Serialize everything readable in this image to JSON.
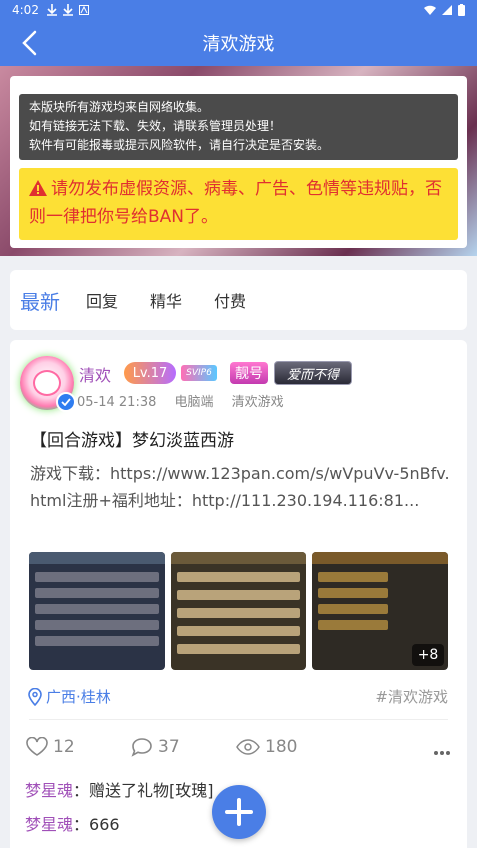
{
  "status_bar": {
    "time": "4:02"
  },
  "app_bar": {
    "title": "清欢游戏"
  },
  "notice": {
    "lines": [
      "本版块所有游戏均来自网络收集。",
      "如有链接无法下载、失效，请联系管理员处理！",
      "软件有可能报毒或提示风险软件，请自行决定是否安装。"
    ],
    "warning": "请勿发布虚假资源、病毒、广告、色情等违规贴，否则一律把你号给BAN了。"
  },
  "tabs": [
    {
      "label": "最新",
      "active": true
    },
    {
      "label": "回复",
      "active": false
    },
    {
      "label": "精华",
      "active": false
    },
    {
      "label": "付费",
      "active": false
    }
  ],
  "post": {
    "author": "清欢",
    "level": "Lv.17",
    "vip": "SVIP6",
    "badge_liang": "靓号",
    "badge_title": "爱而不得",
    "date": "05-14 21:38",
    "device": "电脑端",
    "board": "清欢游戏",
    "title": "【回合游戏】梦幻淡蓝西游",
    "body": "游戏下载：https://www.123pan.com/s/wVpuVv-5nBfv.html注册+福利地址：http://111.230.194.116:81...",
    "more_images": "+8",
    "location": "广西·桂林",
    "hashtag": "#清欢游戏",
    "likes": "12",
    "comments": "37",
    "views": "180"
  },
  "comments": [
    {
      "user": "梦星魂",
      "sep": "：",
      "text": "赠送了礼物[玫瑰]"
    },
    {
      "user": "梦星魂",
      "sep": "：",
      "text": "666"
    }
  ],
  "colors": {
    "primary": "#4a7ee6",
    "warning_bg": "#fde035",
    "warning_text": "#e03030",
    "username": "#a050b8"
  }
}
